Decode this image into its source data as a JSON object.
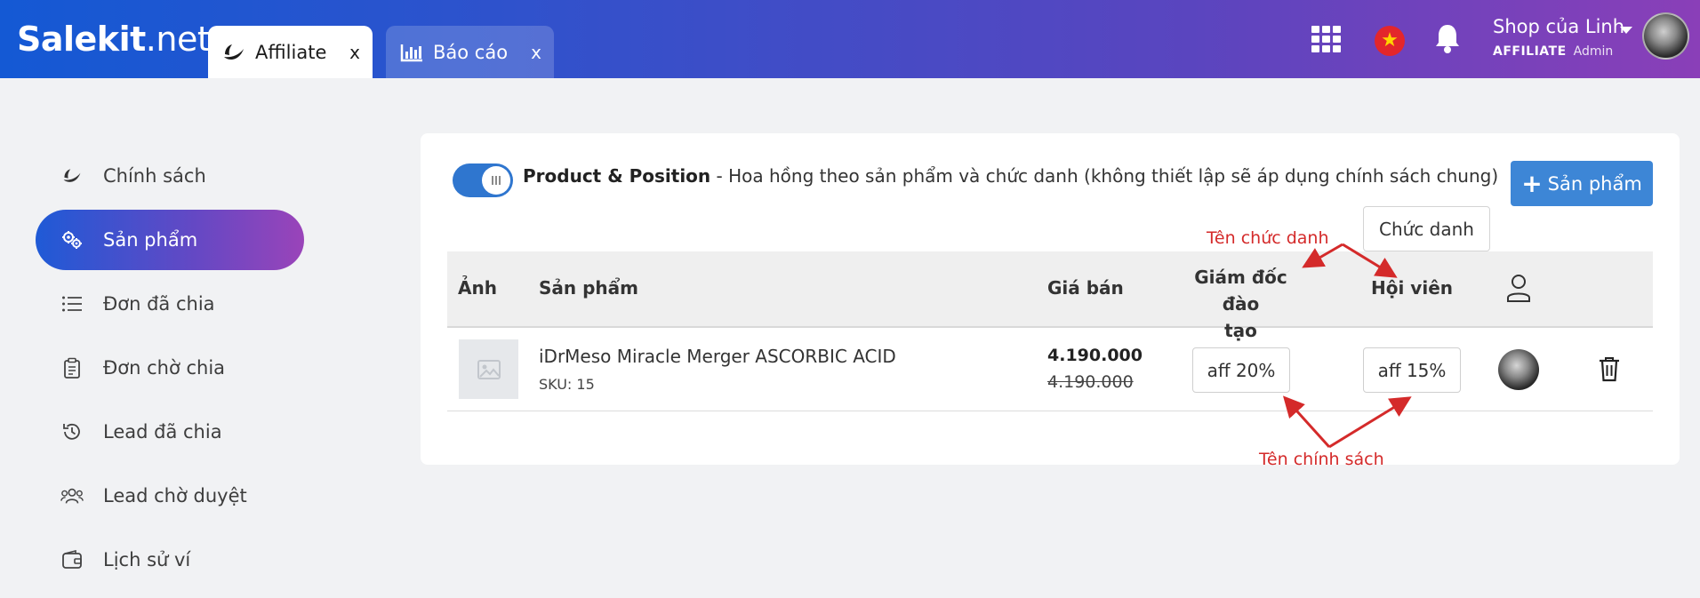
{
  "header": {
    "logo_main": "Salekit",
    "logo_suffix": ".net",
    "tabs": [
      {
        "label": "Affiliate",
        "close": "x"
      },
      {
        "label": "Báo cáo",
        "close": "x"
      }
    ],
    "flag_star": "★",
    "shop_name": "Shop của Linh",
    "role_primary": "AFFILIATE",
    "role_secondary": "Admin"
  },
  "sidebar": {
    "items": [
      {
        "label": "Chính sách",
        "icon": "leaf-icon"
      },
      {
        "label": "Sản phẩm",
        "icon": "gears-icon"
      },
      {
        "label": "Đơn đã chia",
        "icon": "list-icon"
      },
      {
        "label": "Đơn chờ chia",
        "icon": "clipboard-icon"
      },
      {
        "label": "Lead đã chia",
        "icon": "history-icon"
      },
      {
        "label": "Lead chờ duyệt",
        "icon": "users-icon"
      },
      {
        "label": "Lịch sử ví",
        "icon": "wallet-icon"
      }
    ]
  },
  "policy": {
    "title": "Product & Position",
    "description": " - Hoa hồng theo sản phẩm và chức danh (không thiết lập sẽ áp dụng chính sách chung)",
    "toggle_on": true
  },
  "buttons": {
    "add_product": "Sản phẩm",
    "add_plus": "+",
    "position": "Chức danh"
  },
  "table": {
    "headers": {
      "image": "Ảnh",
      "product": "Sản phẩm",
      "price": "Giá bán",
      "position1_line1": "Giám đốc đào",
      "position1_line2": "tạo",
      "position2": "Hội viên"
    },
    "rows": [
      {
        "name": "iDrMeso Miracle Merger ASCORBIC ACID",
        "sku": "SKU: 15",
        "price": "4.190.000",
        "original_price": "4.190.000",
        "aff1": "aff 20%",
        "aff2": "aff 15%"
      }
    ]
  },
  "annotations": {
    "position_name": "Tên chức danh",
    "policy_name": "Tên chính sách",
    "color": "#d42a2a"
  },
  "colors": {
    "primary": "#3d86d6",
    "toggle": "#2f76cf",
    "annotation": "#d42a2a"
  }
}
